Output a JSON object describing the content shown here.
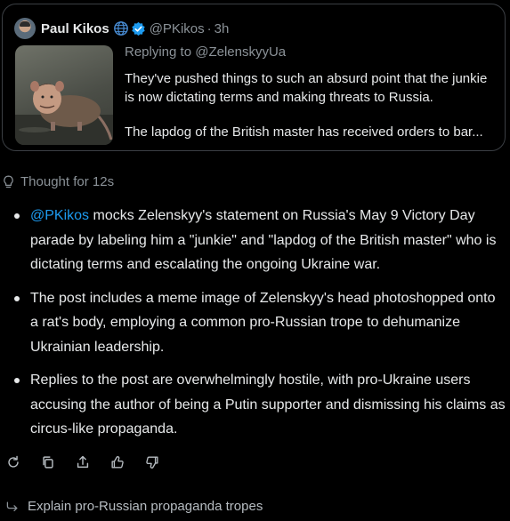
{
  "quoted_post": {
    "author_name": "Paul Kikos",
    "handle": "@PKikos",
    "separator": "·",
    "time": "3h",
    "replying_to": "Replying to @ZelenskyyUa",
    "text_paragraph_1": "They've pushed things to such an absurd point that the junkie is now dictating terms and making threats to Russia.",
    "text_paragraph_2": "The lapdog of the British master has received orders to bar...",
    "icons": [
      "globe-icon",
      "verified-icon"
    ],
    "verified_color": "#1d9bf0"
  },
  "thought": {
    "label": "Thought for 12s",
    "icon": "lightbulb-icon"
  },
  "summary": {
    "bullet_1_mention": "@PKikos",
    "bullet_1_rest": " mocks Zelenskyy's statement on Russia's May 9 Victory Day parade by labeling him a \"junkie\" and \"lapdog of the British master\" who is dictating terms and escalating the ongoing Ukraine war.",
    "bullet_2": "The post includes a meme image of Zelenskyy's head photoshopped onto a rat's body, employing a common pro-Russian trope to dehumanize Ukrainian leadership.",
    "bullet_3": "Replies to the post are overwhelmingly hostile, with pro-Ukraine users accusing the author of being a Putin supporter and dismissing his claims as circus-like propaganda."
  },
  "actions": [
    "regenerate-icon",
    "copy-icon",
    "share-icon",
    "thumbs-up-icon",
    "thumbs-down-icon"
  ],
  "suggestion": {
    "label": "Explain pro-Russian propaganda tropes",
    "icon": "arrow-return-icon"
  },
  "colors": {
    "background": "#000000",
    "text": "#e7e9ea",
    "muted": "#8b9298",
    "link": "#1d9bf0",
    "border": "#3b3f44"
  }
}
